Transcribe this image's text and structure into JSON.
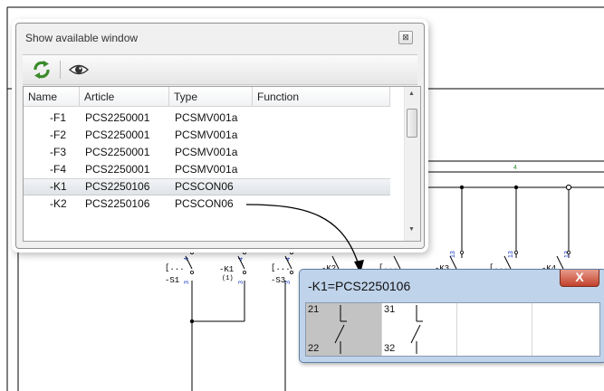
{
  "panel": {
    "title": "Show available window",
    "close_glyph": "⊠",
    "toolbar": {
      "refresh_icon": "refresh-icon",
      "view_icon": "eye-icon"
    },
    "columns": [
      "Name",
      "Article",
      "Type",
      "Function"
    ],
    "rows": [
      {
        "name": "-F1",
        "article": "PCS2250001",
        "type": "PCSMV001a",
        "function": ""
      },
      {
        "name": "-F2",
        "article": "PCS2250001",
        "type": "PCSMV001a",
        "function": ""
      },
      {
        "name": "-F3",
        "article": "PCS2250001",
        "type": "PCSMV001a",
        "function": ""
      },
      {
        "name": "-F4",
        "article": "PCS2250001",
        "type": "PCSMV001a",
        "function": ""
      },
      {
        "name": "-K1",
        "article": "PCS2250106",
        "type": "PCSCON06",
        "function": ""
      },
      {
        "name": "-K2",
        "article": "PCS2250106",
        "type": "PCSCON06",
        "function": ""
      }
    ],
    "selected_row": 4
  },
  "popup": {
    "title": "-K1=PCS2250106",
    "close_glyph": "X",
    "contacts": [
      {
        "top": "21",
        "bottom": "22"
      },
      {
        "top": "31",
        "bottom": "32"
      }
    ]
  },
  "schematic": {
    "column_marker": "4",
    "devices": [
      {
        "ref": "-S1",
        "contact": "4",
        "bracket": "[...",
        "bottom": "3"
      },
      {
        "ref": "-K1",
        "contact": "4",
        "bracket": "(1)",
        "bottom": "3"
      },
      {
        "ref": "-S3",
        "contact": "4",
        "bracket": "[...",
        "bottom": "3"
      },
      {
        "ref": "-K2",
        "contact": "",
        "bracket": "",
        "bottom": ""
      },
      {
        "ref": "",
        "contact": "",
        "bracket": "[...",
        "bottom": ""
      },
      {
        "ref": "-K3",
        "contact": "",
        "bracket": "",
        "bottom": ""
      },
      {
        "ref": "",
        "contact": "",
        "bracket": "[...",
        "bottom": ""
      },
      {
        "ref": "-K4",
        "contact": "",
        "bracket": "",
        "bottom": ""
      }
    ],
    "tags": [
      "13",
      "13",
      "13"
    ]
  },
  "colors": {
    "selection": "#dfe3e7",
    "popup_frame": "#bfd3ea",
    "close_red": "#c2422c",
    "wire": "#000000",
    "ref_blue": "#1a3cc8",
    "marker_green": "#2f8f2f"
  }
}
